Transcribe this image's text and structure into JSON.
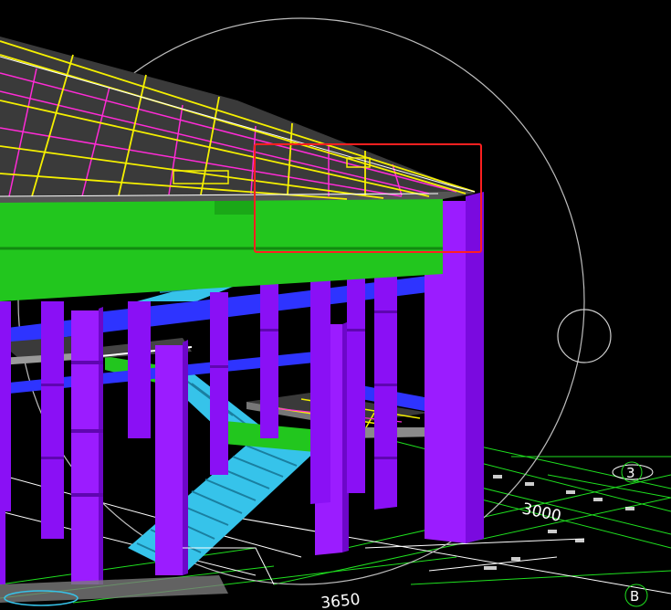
{
  "viewport": {
    "background": "#000000",
    "view": "3D perspective"
  },
  "annotations": {
    "dimension_main": "3000",
    "dimension_bottom": "3650",
    "axis_marker_3": "3",
    "axis_marker_b": "B"
  },
  "selection": {
    "color": "#ff2020"
  },
  "colors": {
    "column": "#8a10f5",
    "beam_green": "#22c61e",
    "beam_blue": "#2e34ff",
    "stair": "#36c3ea",
    "slab": "#3a3a3a",
    "rebar_yellow": "#f5f000",
    "rebar_magenta": "#ff2bd6",
    "grid_green": "#1fe01f",
    "orbit_circle": "#bdbdbd"
  }
}
